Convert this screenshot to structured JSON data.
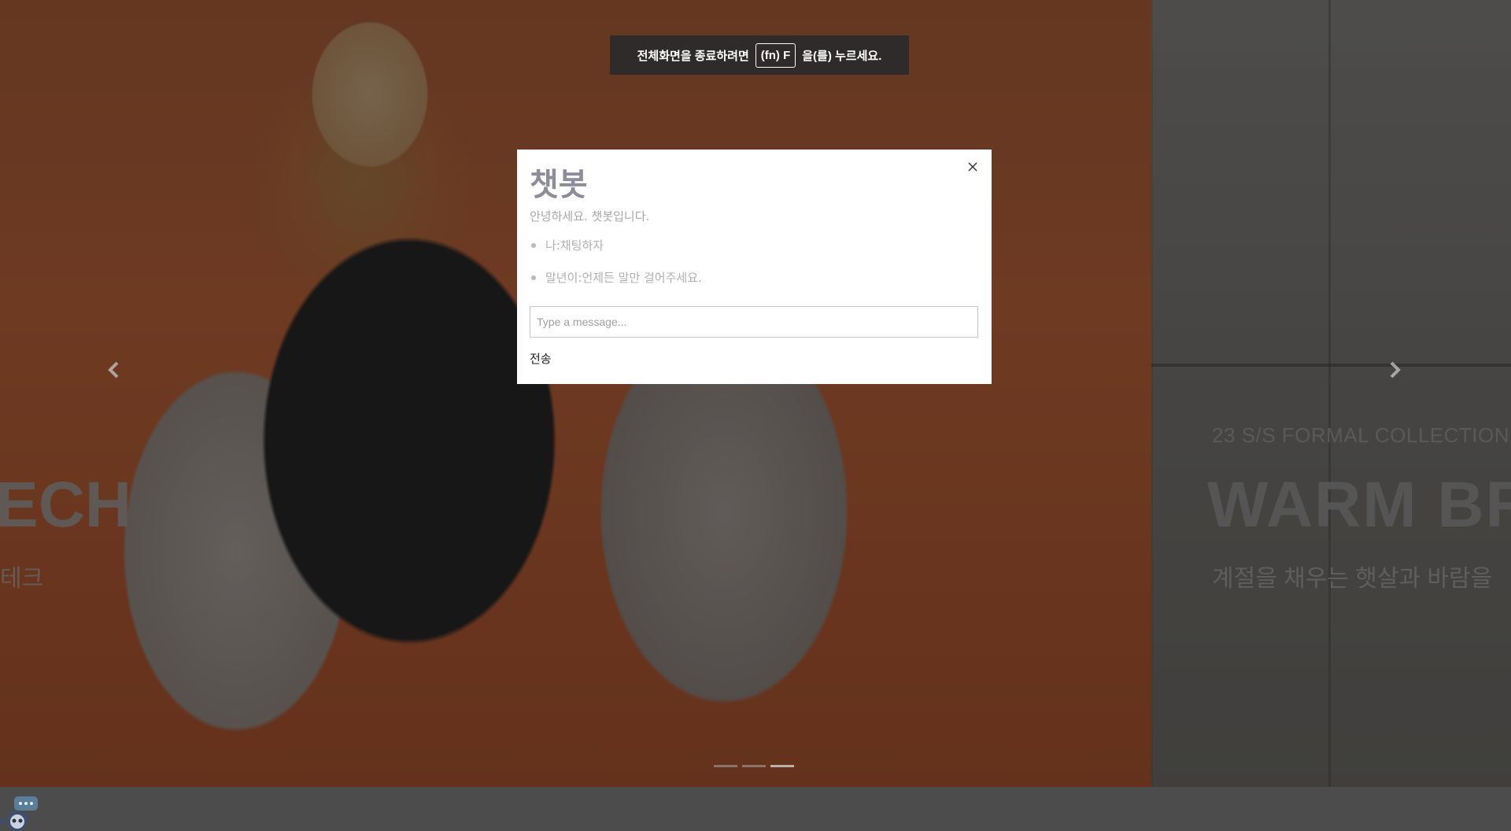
{
  "fullscreen_notice": {
    "prefix": "전체화면을 종료하려면",
    "key": "(fn) F",
    "suffix": "을(를) 누르세요."
  },
  "carousel": {
    "slides": [
      {
        "title": "ECH",
        "subtitle": "테크"
      },
      {
        "eyebrow": "23 S/S FORMAL COLLECTION",
        "title": "WARM BR",
        "subtitle": "계절을 채우는 햇살과 바람을"
      }
    ],
    "prev_icon": "chevron-left-icon",
    "next_icon": "chevron-right-icon",
    "indicator_count": 3,
    "active_indicator": 3
  },
  "chatbot": {
    "title": "챗봇",
    "greeting": "안녕하세요. 챗봇입니다.",
    "messages": [
      {
        "text": "나:채팅하자"
      },
      {
        "text": "말년이:언제든 말만 걸어주세요."
      }
    ],
    "input_placeholder": "Type a message...",
    "send_label": "전송",
    "close_icon": "close-icon"
  },
  "launcher": {
    "icon": "chatbot-robot-icon"
  },
  "colors": {
    "toast_bg": "#2f2b2b",
    "modal_title": "#8d8d99",
    "slide1_bg": "#c96a3e",
    "slide2_bg": "#8d8b88",
    "footer_bg": "#8a8a8a"
  }
}
